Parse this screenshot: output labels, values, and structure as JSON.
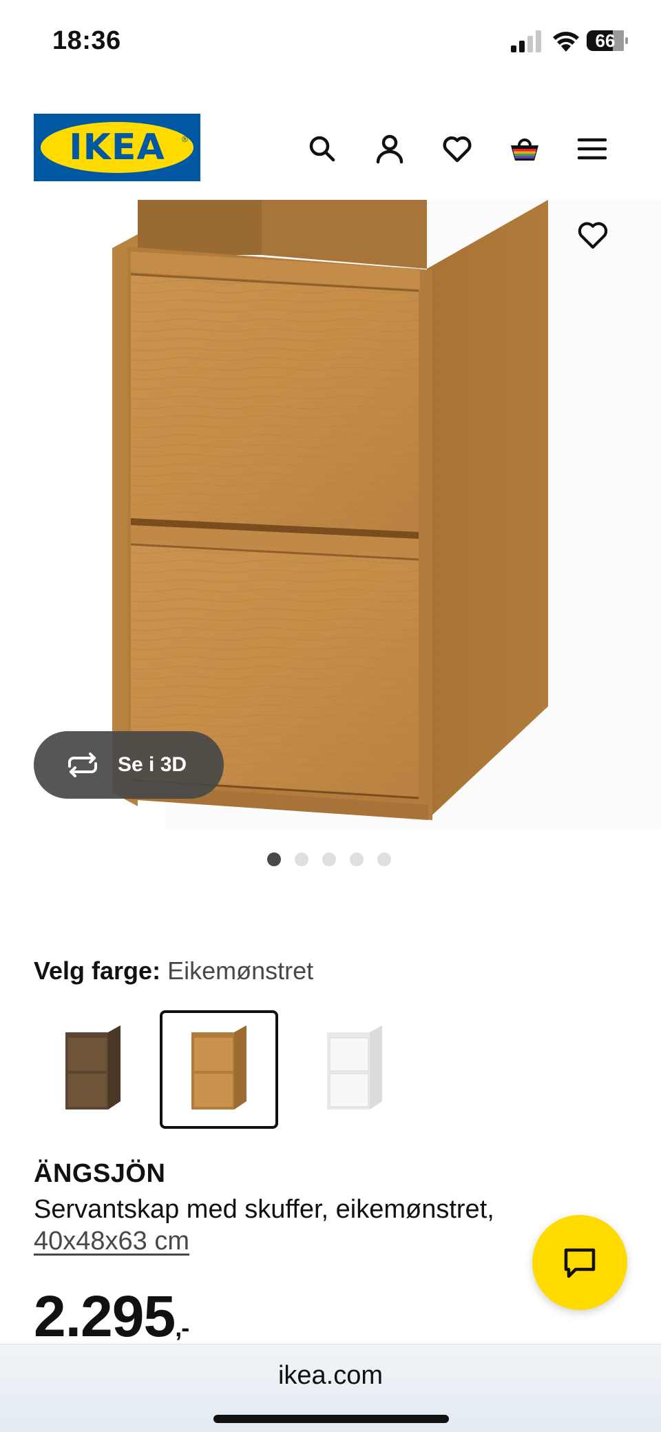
{
  "status_bar": {
    "time": "18:36",
    "battery": "66"
  },
  "header": {
    "logo_text": "IKEA",
    "icons": [
      "search-icon",
      "account-icon",
      "heart-icon",
      "basket-icon",
      "menu-icon"
    ]
  },
  "gallery": {
    "view_3d_label": "Se i 3D",
    "image_count": 5,
    "active_index": 0
  },
  "color_picker": {
    "label": "Velg farge:",
    "selected_value": "Eikemønstret",
    "options": [
      "brown-oak-effect",
      "oak-effect",
      "white"
    ]
  },
  "product": {
    "name": "ÄNGSJÖN",
    "description": "Servantskap med skuffer, eikemønstret,",
    "size": "40x48x63 cm",
    "price": "2.295",
    "price_suffix": ",-"
  },
  "browser": {
    "url": "ikea.com"
  },
  "colors": {
    "brand_blue": "#0058a3",
    "brand_yellow": "#ffdb00"
  }
}
